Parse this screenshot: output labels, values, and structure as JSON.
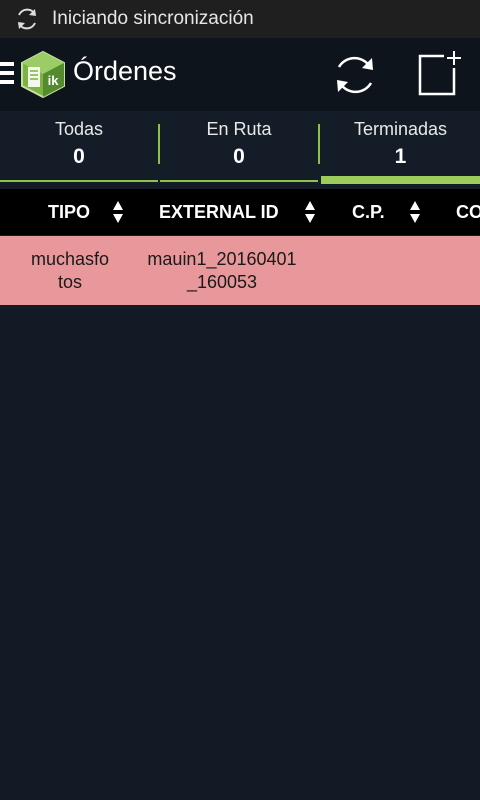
{
  "status_bar": {
    "text": "Iniciando sincronización",
    "icon": "sync-icon"
  },
  "action_bar": {
    "title": "Órdenes",
    "menu_icon": "hamburger-menu-icon",
    "logo_text": "ik",
    "refresh_icon": "refresh-icon",
    "new_icon": "new-document-icon",
    "background": "#0e141c"
  },
  "tabs": [
    {
      "label": "Todas",
      "count": "0",
      "selected": false
    },
    {
      "label": "En Ruta",
      "count": "0",
      "selected": false
    },
    {
      "label": "Terminadas",
      "count": "1",
      "selected": true
    }
  ],
  "table": {
    "columns": [
      {
        "label": "TIPO",
        "sort_icon": "sort-arrows-icon"
      },
      {
        "label": "EXTERNAL ID",
        "sort_icon": "sort-arrows-icon"
      },
      {
        "label": "C.P.",
        "sort_icon": "sort-arrows-icon"
      },
      {
        "label": "CO"
      }
    ],
    "rows": [
      {
        "tipo_line1": "muchasfo",
        "tipo_line2": "tos",
        "external_id_line1": "mauin1_20160401",
        "external_id_line2": "_160053",
        "cp": "",
        "row_color": "#e8979a"
      }
    ]
  },
  "colors": {
    "accent_green": "#8bc34a",
    "background": "#121b25",
    "row_highlight": "#e8979a"
  }
}
